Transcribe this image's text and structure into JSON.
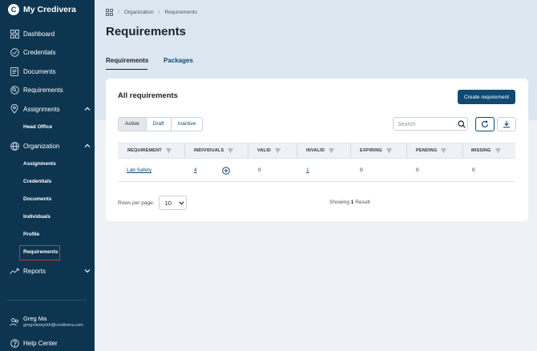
{
  "brand": {
    "name": "My Credivera",
    "logo_letter": "C"
  },
  "sidebar": {
    "items": [
      {
        "label": "Dashboard",
        "icon": "dashboard-icon"
      },
      {
        "label": "Credentials",
        "icon": "check-circle-icon"
      },
      {
        "label": "Documents",
        "icon": "document-icon"
      },
      {
        "label": "Requirements",
        "icon": "requirements-icon"
      },
      {
        "label": "Assignments",
        "icon": "location-pin-icon",
        "expanded": true
      },
      {
        "label": "Organization",
        "icon": "globe-icon",
        "expanded": true
      },
      {
        "label": "Reports",
        "icon": "trend-chart-icon",
        "expanded": false
      }
    ],
    "assignments_sub": [
      "Head Office"
    ],
    "organization_sub": [
      "Assignments",
      "Credentials",
      "Documents",
      "Individuals",
      "Profile",
      "Requirements"
    ],
    "active_sub": "Requirements",
    "user": {
      "name": "Greg Ma",
      "email": "greg+biosynth@credivera.com"
    },
    "help": "Help Center"
  },
  "breadcrumb": {
    "home_icon": "grid-icon",
    "items": [
      "Organization",
      "Requirements"
    ]
  },
  "page": {
    "title": "Requirements",
    "tabs": [
      "Requirements",
      "Packages"
    ],
    "active_tab": "Requirements"
  },
  "card": {
    "title": "All requirements",
    "create_button": "Create requirement",
    "status_filters": [
      "Active",
      "Draft",
      "Inactive"
    ],
    "active_status": "Active",
    "search_placeholder": "Search",
    "columns": [
      "REQUIREMENT",
      "INDIVIDUALS",
      "VALID",
      "INVALID",
      "EXPIRING",
      "PENDING",
      "MISSING"
    ],
    "rows": [
      {
        "requirement": "Lab Safety",
        "individuals": "4",
        "valid": "0",
        "invalid": "1",
        "expiring": "0",
        "pending": "0",
        "missing": "0"
      }
    ],
    "rows_per_page_label": "Rows per page:",
    "rows_per_page_value": "10",
    "showing_prefix": "Showing",
    "showing_count": "1",
    "showing_suffix": "Result"
  },
  "colors": {
    "sidebar_bg": "#0d3550",
    "accent": "#0d4a74",
    "band": "#dde7f1",
    "active_outline": "#d9302c"
  }
}
